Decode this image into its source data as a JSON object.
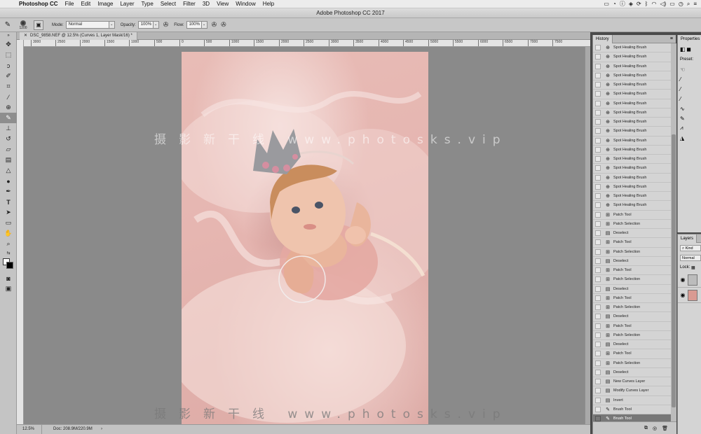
{
  "menubar": {
    "app": "Photoshop CC",
    "items": [
      "File",
      "Edit",
      "Image",
      "Layer",
      "Type",
      "Select",
      "Filter",
      "3D",
      "View",
      "Window",
      "Help"
    ]
  },
  "window_title": "Adobe Photoshop CC 2017",
  "options": {
    "brush_size": "1200",
    "mode_label": "Mode:",
    "mode_value": "Normal",
    "opacity_label": "Opacity:",
    "opacity_value": "100%",
    "flow_label": "Flow:",
    "flow_value": "100%"
  },
  "document_tab": "DSC_9858.NEF @ 12.5% (Curves 1, Layer Mask/16) *",
  "ruler_ticks": [
    "3000",
    "2500",
    "2000",
    "1500",
    "1000",
    "500",
    "0",
    "500",
    "1000",
    "1500",
    "2000",
    "2500",
    "3000",
    "3500",
    "4000",
    "4500",
    "5000",
    "5500",
    "6000",
    "6500",
    "7000",
    "7500"
  ],
  "status": {
    "zoom": "12.5%",
    "doc": "Doc: 208.9M/220.9M"
  },
  "watermark": {
    "chinese": "摄影新干线",
    "url": "www.photosks.vip"
  },
  "history": {
    "title": "History",
    "items": [
      {
        "label": "Spot Healing Brush",
        "icon": "spot-healing-icon"
      },
      {
        "label": "Spot Healing Brush",
        "icon": "spot-healing-icon"
      },
      {
        "label": "Spot Healing Brush",
        "icon": "spot-healing-icon"
      },
      {
        "label": "Spot Healing Brush",
        "icon": "spot-healing-icon"
      },
      {
        "label": "Spot Healing Brush",
        "icon": "spot-healing-icon"
      },
      {
        "label": "Spot Healing Brush",
        "icon": "spot-healing-icon"
      },
      {
        "label": "Spot Healing Brush",
        "icon": "spot-healing-icon"
      },
      {
        "label": "Spot Healing Brush",
        "icon": "spot-healing-icon"
      },
      {
        "label": "Spot Healing Brush",
        "icon": "spot-healing-icon"
      },
      {
        "label": "Spot Healing Brush",
        "icon": "spot-healing-icon"
      },
      {
        "label": "Spot Healing Brush",
        "icon": "spot-healing-icon"
      },
      {
        "label": "Spot Healing Brush",
        "icon": "spot-healing-icon"
      },
      {
        "label": "Spot Healing Brush",
        "icon": "spot-healing-icon"
      },
      {
        "label": "Spot Healing Brush",
        "icon": "spot-healing-icon"
      },
      {
        "label": "Spot Healing Brush",
        "icon": "spot-healing-icon"
      },
      {
        "label": "Spot Healing Brush",
        "icon": "spot-healing-icon"
      },
      {
        "label": "Spot Healing Brush",
        "icon": "spot-healing-icon"
      },
      {
        "label": "Spot Healing Brush",
        "icon": "spot-healing-icon"
      },
      {
        "label": "Patch Tool",
        "icon": "patch-icon"
      },
      {
        "label": "Patch Selection",
        "icon": "patch-icon"
      },
      {
        "label": "Deselect",
        "icon": "history-step-icon"
      },
      {
        "label": "Patch Tool",
        "icon": "patch-icon"
      },
      {
        "label": "Patch Selection",
        "icon": "patch-icon"
      },
      {
        "label": "Deselect",
        "icon": "history-step-icon"
      },
      {
        "label": "Patch Tool",
        "icon": "patch-icon"
      },
      {
        "label": "Patch Selection",
        "icon": "patch-icon"
      },
      {
        "label": "Deselect",
        "icon": "history-step-icon"
      },
      {
        "label": "Patch Tool",
        "icon": "patch-icon"
      },
      {
        "label": "Patch Selection",
        "icon": "patch-icon"
      },
      {
        "label": "Deselect",
        "icon": "history-step-icon"
      },
      {
        "label": "Patch Tool",
        "icon": "patch-icon"
      },
      {
        "label": "Patch Selection",
        "icon": "patch-icon"
      },
      {
        "label": "Deselect",
        "icon": "history-step-icon"
      },
      {
        "label": "Patch Tool",
        "icon": "patch-icon"
      },
      {
        "label": "Patch Selection",
        "icon": "patch-icon"
      },
      {
        "label": "Deselect",
        "icon": "history-step-icon"
      },
      {
        "label": "New Curves Layer",
        "icon": "history-step-icon"
      },
      {
        "label": "Modify Curves Layer",
        "icon": "history-step-icon"
      },
      {
        "label": "Invert",
        "icon": "history-step-icon"
      },
      {
        "label": "Brush Tool",
        "icon": "brush-icon"
      },
      {
        "label": "Brush Tool",
        "icon": "brush-icon",
        "active": true
      }
    ]
  },
  "properties": {
    "title": "Properties",
    "preset_label": "Preset:"
  },
  "layers": {
    "title": "Layers",
    "kind_label": "Kind",
    "blend_mode": "Normal",
    "lock_label": "Lock:"
  }
}
